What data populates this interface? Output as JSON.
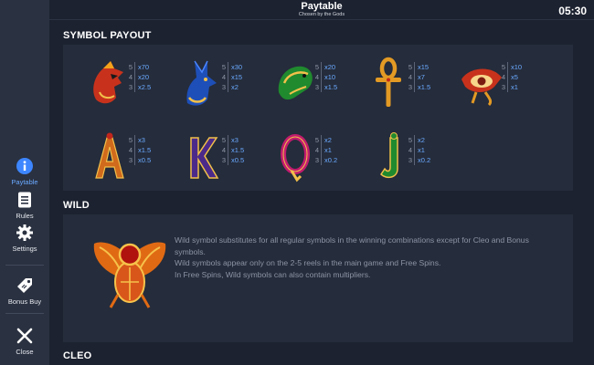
{
  "header": {
    "title": "Paytable",
    "subtitle": "Chosen by the Gods",
    "clock": "05:30"
  },
  "sidebar": {
    "items": [
      {
        "label": "Paytable",
        "icon": "info-icon"
      },
      {
        "label": "Rules",
        "icon": "document-icon"
      },
      {
        "label": "Settings",
        "icon": "gear-icon"
      },
      {
        "label": "Bonus Buy",
        "icon": "tag-icon"
      },
      {
        "label": "Close",
        "icon": "close-icon"
      }
    ]
  },
  "sections": {
    "symbol_payout": {
      "title": "SYMBOL PAYOUT"
    },
    "wild": {
      "title": "WILD",
      "lines": [
        "Wild symbol substitutes for all regular symbols in the winning combinations except for Cleo and Bonus symbols.",
        "Wild symbols appear only on the 2-5 reels in the main game and Free Spins.",
        "In Free Spins, Wild symbols can also contain multipliers."
      ]
    },
    "cleo": {
      "title": "CLEO"
    }
  },
  "symbols": [
    {
      "name": "Horus",
      "icon": "horus-icon",
      "pays": [
        {
          "count": "5",
          "mult": "x70"
        },
        {
          "count": "4",
          "mult": "x20"
        },
        {
          "count": "3",
          "mult": "x2.5"
        }
      ]
    },
    {
      "name": "Anubis",
      "icon": "anubis-icon",
      "pays": [
        {
          "count": "5",
          "mult": "x30"
        },
        {
          "count": "4",
          "mult": "x15"
        },
        {
          "count": "3",
          "mult": "x2"
        }
      ]
    },
    {
      "name": "Cobra",
      "icon": "cobra-icon",
      "pays": [
        {
          "count": "5",
          "mult": "x20"
        },
        {
          "count": "4",
          "mult": "x10"
        },
        {
          "count": "3",
          "mult": "x1.5"
        }
      ]
    },
    {
      "name": "Ankh",
      "icon": "ankh-icon",
      "pays": [
        {
          "count": "5",
          "mult": "x15"
        },
        {
          "count": "4",
          "mult": "x7"
        },
        {
          "count": "3",
          "mult": "x1.5"
        }
      ]
    },
    {
      "name": "Eye of Ra",
      "icon": "eye-of-ra-icon",
      "pays": [
        {
          "count": "5",
          "mult": "x10"
        },
        {
          "count": "4",
          "mult": "x5"
        },
        {
          "count": "3",
          "mult": "x1"
        }
      ]
    },
    {
      "name": "A",
      "icon": "letter-a-icon",
      "pays": [
        {
          "count": "5",
          "mult": "x3"
        },
        {
          "count": "4",
          "mult": "x1.5"
        },
        {
          "count": "3",
          "mult": "x0.5"
        }
      ]
    },
    {
      "name": "K",
      "icon": "letter-k-icon",
      "pays": [
        {
          "count": "5",
          "mult": "x3"
        },
        {
          "count": "4",
          "mult": "x1.5"
        },
        {
          "count": "3",
          "mult": "x0.5"
        }
      ]
    },
    {
      "name": "Q",
      "icon": "letter-q-icon",
      "pays": [
        {
          "count": "5",
          "mult": "x2"
        },
        {
          "count": "4",
          "mult": "x1"
        },
        {
          "count": "3",
          "mult": "x0.2"
        }
      ]
    },
    {
      "name": "J",
      "icon": "letter-j-icon",
      "pays": [
        {
          "count": "5",
          "mult": "x2"
        },
        {
          "count": "4",
          "mult": "x1"
        },
        {
          "count": "3",
          "mult": "x0.2"
        }
      ]
    }
  ],
  "colors": {
    "accent": "#6aa9ff",
    "background": "#1c2230",
    "panel": "#252c3b",
    "sidebar": "#2a3140"
  }
}
